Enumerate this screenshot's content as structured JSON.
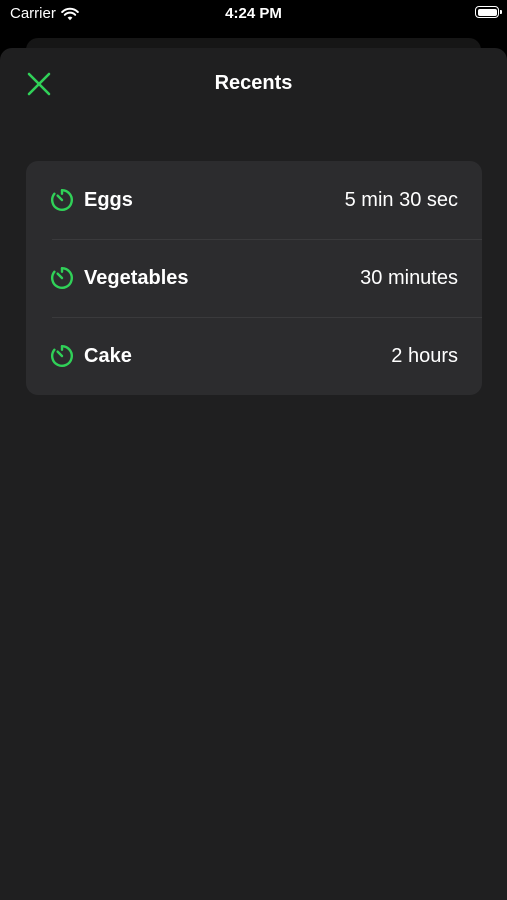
{
  "status_bar": {
    "carrier": "Carrier",
    "time": "4:24 PM",
    "wifi_icon": "wifi-icon",
    "battery_icon": "battery-full-icon"
  },
  "header": {
    "title": "Recents",
    "close_icon": "close-x-icon"
  },
  "recents": [
    {
      "label": "Eggs",
      "duration": "5 min 30 sec",
      "icon": "timer-icon"
    },
    {
      "label": "Vegetables",
      "duration": "30 minutes",
      "icon": "timer-icon"
    },
    {
      "label": "Cake",
      "duration": "2 hours",
      "icon": "timer-icon"
    }
  ],
  "colors": {
    "accent": "#30d158",
    "sheet_background": "#1f1f20",
    "card_background": "#2c2c2e",
    "separator": "#3a3a3c"
  }
}
